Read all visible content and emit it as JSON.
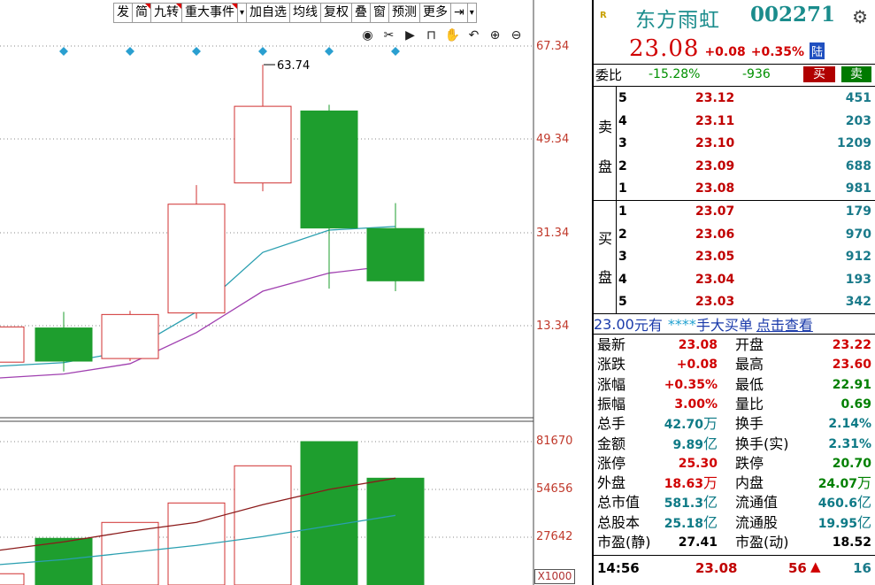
{
  "toolbar": {
    "items": [
      "发",
      "简",
      "九转",
      "重大事件",
      "▾",
      "加自选",
      "均线",
      "复权",
      "叠",
      "窗",
      "预测",
      "更多",
      "⇥",
      "▾"
    ]
  },
  "chart_data": {
    "type": "candlestick",
    "ylim_price": [
      4.0,
      72.0
    ],
    "y_ticks_price": [
      "67.34",
      "49.34",
      "31.34",
      "13.34"
    ],
    "y_ticks_volume": [
      "81670",
      "54656",
      "27642"
    ],
    "volume_unit": "X1000",
    "high_annotation": "63.74",
    "candles": [
      {
        "open": 13.1,
        "close": 6.3,
        "high": 13.5,
        "low": 6.0,
        "dir": "up",
        "partial": true
      },
      {
        "open": 12.9,
        "close": 6.5,
        "high": 16.0,
        "low": 4.5,
        "dir": "down"
      },
      {
        "open": 7.0,
        "close": 15.5,
        "high": 16.2,
        "low": 6.5,
        "dir": "up"
      },
      {
        "open": 15.8,
        "close": 36.8,
        "high": 40.5,
        "low": 14.7,
        "dir": "up"
      },
      {
        "open": 40.9,
        "close": 55.7,
        "high": 63.74,
        "low": 39.3,
        "dir": "up"
      },
      {
        "open": 54.8,
        "close": 32.2,
        "high": 56.0,
        "low": 20.5,
        "dir": "down"
      },
      {
        "open": 32.1,
        "close": 22.0,
        "high": 37.0,
        "low": 20.0,
        "dir": "down"
      }
    ],
    "ma_short": [
      5.5,
      6.2,
      8.5,
      16.0,
      27.5,
      31.8,
      32.5
    ],
    "ma_long": [
      3.2,
      4.0,
      6.0,
      12.0,
      20.0,
      23.5,
      25.0
    ],
    "volumes": [
      7000,
      27000,
      36000,
      47000,
      68000,
      81670,
      61000
    ],
    "vol_ma_short": [
      20000,
      25000,
      31000,
      36000,
      46000,
      54656,
      61000
    ],
    "vol_ma_long": [
      12000,
      15000,
      19000,
      23000,
      28000,
      34000,
      40000
    ],
    "markers_count": 6
  },
  "quote": {
    "badge": "R",
    "name": "东方雨虹",
    "code": "002271",
    "price": "23.08",
    "change": "+0.08",
    "pct": "+0.35%",
    "exchange_badge": "陆",
    "weibi_label": "委比",
    "weibi_pct": "-15.28%",
    "weibi_diff": "-936",
    "buy_label": "买",
    "sell_label": "卖",
    "sell_side_label": [
      "卖",
      "盘"
    ],
    "buy_side_label": [
      "买",
      "盘"
    ],
    "asks": [
      {
        "level": "5",
        "price": "23.12",
        "vol": "451"
      },
      {
        "level": "4",
        "price": "23.11",
        "vol": "203"
      },
      {
        "level": "3",
        "price": "23.10",
        "vol": "1209"
      },
      {
        "level": "2",
        "price": "23.09",
        "vol": "688"
      },
      {
        "level": "1",
        "price": "23.08",
        "vol": "981"
      }
    ],
    "bids": [
      {
        "level": "1",
        "price": "23.07",
        "vol": "179"
      },
      {
        "level": "2",
        "price": "23.06",
        "vol": "970"
      },
      {
        "level": "3",
        "price": "23.05",
        "vol": "912"
      },
      {
        "level": "4",
        "price": "23.04",
        "vol": "193"
      },
      {
        "level": "5",
        "price": "23.03",
        "vol": "342"
      }
    ],
    "bigorder": {
      "price": "23.00",
      "t1": "元有",
      "stars": "****",
      "t2": "手",
      "t3": "大买单",
      "link": "点击查看"
    },
    "stats": [
      [
        "最新",
        "23.08",
        "",
        "red",
        "开盘",
        "23.22",
        "",
        "red"
      ],
      [
        "涨跌",
        "+0.08",
        "",
        "red",
        "最高",
        "23.60",
        "",
        "red"
      ],
      [
        "涨幅",
        "+0.35%",
        "",
        "red",
        "最低",
        "22.91",
        "",
        "green"
      ],
      [
        "振幅",
        "3.00%",
        "",
        "red",
        "量比",
        "0.69",
        "",
        "green"
      ],
      [
        "总手",
        "42.70",
        "万",
        "teal",
        "换手",
        "2.14%",
        "",
        "teal"
      ],
      [
        "金额",
        "9.89",
        "亿",
        "teal",
        "换手(实)",
        "2.31%",
        "",
        "teal"
      ],
      [
        "涨停",
        "25.30",
        "",
        "red",
        "跌停",
        "20.70",
        "",
        "green"
      ],
      [
        "外盘",
        "18.63",
        "万",
        "red",
        "内盘",
        "24.07",
        "万",
        "green"
      ],
      [
        "总市值",
        "581.3",
        "亿",
        "teal",
        "流通值",
        "460.6",
        "亿",
        "teal"
      ],
      [
        "总股本",
        "25.18",
        "亿",
        "teal",
        "流通股",
        "19.95",
        "亿",
        "teal"
      ],
      [
        "市盈(静)",
        "27.41",
        "",
        "blk",
        "市盈(动)",
        "18.52",
        "",
        "blk"
      ]
    ],
    "tick": {
      "time": "14:56",
      "price": "23.08",
      "vol": "56",
      "arrow": "▲",
      "n": "16"
    }
  },
  "colors": {
    "up": "#d03030",
    "down": "#1e9e2e",
    "ma_short": "#2a9fb0",
    "ma_long": "#a040b0",
    "vol_ma_short": "#8b1a1a",
    "vol_ma_long": "#2a9fb0",
    "marker": "#2a9fd0"
  }
}
